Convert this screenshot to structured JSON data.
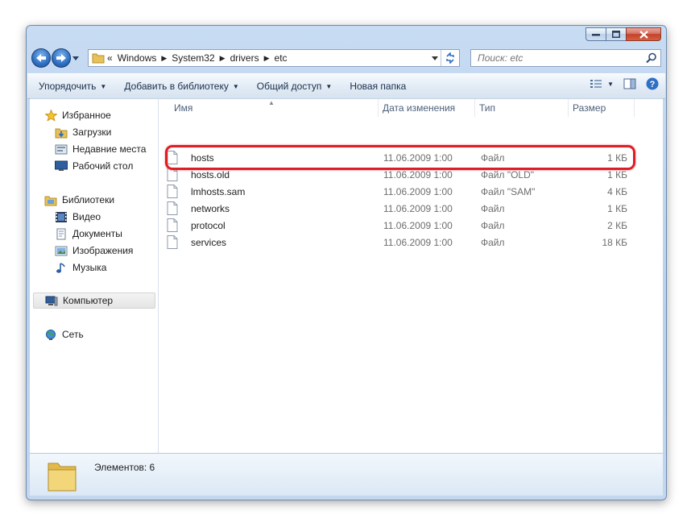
{
  "window": {
    "caption_buttons": [
      "minimize",
      "maximize",
      "close"
    ]
  },
  "address": {
    "breadcrumbs": [
      "«",
      "Windows",
      "System32",
      "drivers",
      "etc"
    ]
  },
  "search": {
    "placeholder": "Поиск: etc"
  },
  "toolbar": {
    "organize": "Упорядочить",
    "add_to_library": "Добавить в библиотеку",
    "share": "Общий доступ",
    "new_folder": "Новая папка"
  },
  "nav": {
    "favorites": "Избранное",
    "downloads": "Загрузки",
    "recent": "Недавние места",
    "desktop": "Рабочий стол",
    "libraries": "Библиотеки",
    "video": "Видео",
    "documents": "Документы",
    "images": "Изображения",
    "music": "Музыка",
    "computer": "Компьютер",
    "network": "Сеть"
  },
  "columns": {
    "name": "Имя",
    "date": "Дата изменения",
    "type": "Тип",
    "size": "Размер"
  },
  "files": [
    {
      "name": "hosts",
      "date": "11.06.2009 1:00",
      "type": "Файл",
      "size": "1 КБ"
    },
    {
      "name": "hosts.old",
      "date": "11.06.2009 1:00",
      "type": "Файл \"OLD\"",
      "size": "1 КБ"
    },
    {
      "name": "lmhosts.sam",
      "date": "11.06.2009 1:00",
      "type": "Файл \"SAM\"",
      "size": "4 КБ"
    },
    {
      "name": "networks",
      "date": "11.06.2009 1:00",
      "type": "Файл",
      "size": "1 КБ"
    },
    {
      "name": "protocol",
      "date": "11.06.2009 1:00",
      "type": "Файл",
      "size": "2 КБ"
    },
    {
      "name": "services",
      "date": "11.06.2009 1:00",
      "type": "Файл",
      "size": "18 КБ"
    }
  ],
  "status": {
    "items_count": "Элементов: 6"
  },
  "colors": {
    "highlight": "#e01c24",
    "accent": "#2e6fc2"
  }
}
